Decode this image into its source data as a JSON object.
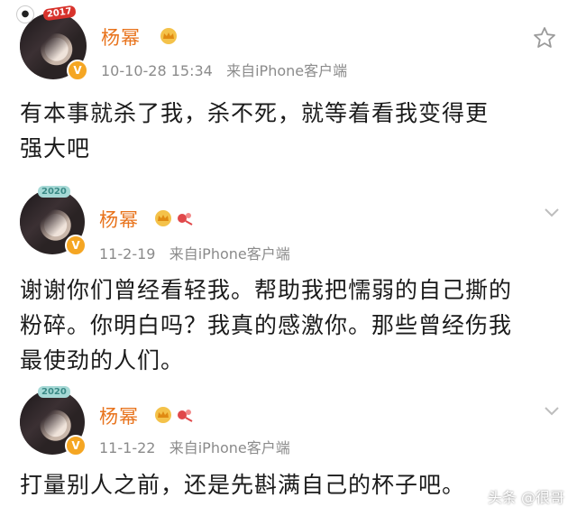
{
  "posts": [
    {
      "author": "杨幂",
      "frame_badge": "2017",
      "timestamp": "10-10-28 15:34",
      "source": "来自iPhone客户端",
      "text_lines": [
        "有本事就杀了我，杀不死，就等着看我变得更",
        "强大吧"
      ],
      "action_icon": "star-icon"
    },
    {
      "author": "杨幂",
      "frame_badge": "2020",
      "timestamp": "11-2-19",
      "source": "来自iPhone客户端",
      "text_lines": [
        "谢谢你们曾经看轻我。帮助我把懦弱的自己撕的",
        "粉碎。你明白吗？我真的感激你。那些曾经伤我",
        "最使劲的人们。"
      ],
      "action_icon": "chevron-down-icon"
    },
    {
      "author": "杨幂",
      "frame_badge": "2020",
      "timestamp": "11-1-22",
      "source": "来自iPhone客户端",
      "text_lines": [
        "打量别人之前，还是先斟满自己的杯子吧。"
      ],
      "action_icon": "chevron-down-icon"
    }
  ],
  "verified_mark": "V",
  "watermark": "头条 @很哥",
  "colors": {
    "name": "#e8731c",
    "meta": "#8b8b8b",
    "text": "#1b1b1b",
    "badge": "#f5a623"
  }
}
